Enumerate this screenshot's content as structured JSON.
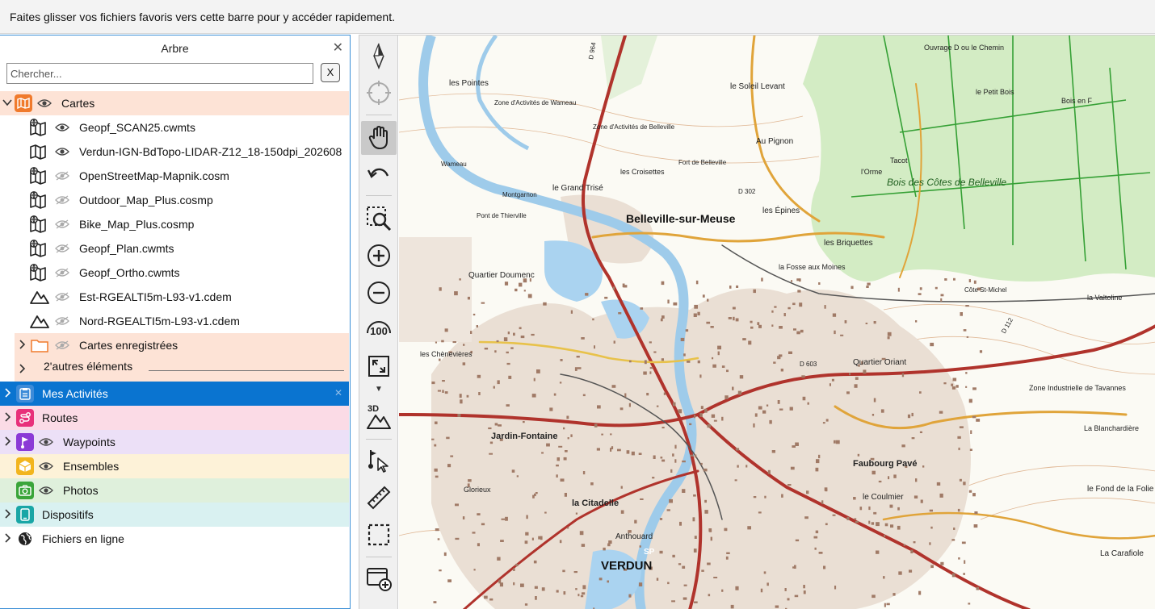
{
  "favorites_bar": {
    "text": "Faites glisser vos fichiers favoris vers cette barre pour y accéder rapidement."
  },
  "panel": {
    "title": "Arbre",
    "close_label": "✕",
    "search": {
      "placeholder": "Chercher...",
      "value": "",
      "clear_label": "X"
    }
  },
  "tree": {
    "cartes": {
      "label": "Cartes",
      "color": "#f07a2c"
    },
    "maps": [
      {
        "label": "Geopf_SCAN25.cwmts",
        "icon": "online-map-icon",
        "visible": true
      },
      {
        "label": "Verdun-IGN-BdTopo-LIDAR-Z12_18-150dpi_202608",
        "icon": "map-icon",
        "visible": true
      },
      {
        "label": "OpenStreetMap-Mapnik.cosm",
        "icon": "online-map-icon",
        "visible": false
      },
      {
        "label": "Outdoor_Map_Plus.cosmp",
        "icon": "online-map-icon",
        "visible": false
      },
      {
        "label": "Bike_Map_Plus.cosmp",
        "icon": "online-map-icon",
        "visible": false
      },
      {
        "label": "Geopf_Plan.cwmts",
        "icon": "online-map-icon",
        "visible": false
      },
      {
        "label": "Geopf_Ortho.cwmts",
        "icon": "online-map-icon",
        "visible": false
      },
      {
        "label": "Est-RGEALTI5m-L93-v1.cdem",
        "icon": "elevation-icon",
        "visible": false
      },
      {
        "label": "Nord-RGEALTI5m-L93-v1.cdem",
        "icon": "elevation-icon",
        "visible": false
      }
    ],
    "saved_maps": {
      "label": "Cartes enregistrées"
    },
    "other_items": {
      "label": "2'autres éléments"
    },
    "sections": [
      {
        "label": "Mes Activités",
        "color": "#3d8bd8",
        "bg": "#0a74d0",
        "selected": true
      },
      {
        "label": "Routes",
        "color": "#e8317a",
        "bg": "#fbdbe6"
      },
      {
        "label": "Waypoints",
        "color": "#8b3ad6",
        "bg": "#ece0f7"
      },
      {
        "label": "Ensembles",
        "color": "#f2b51e",
        "bg": "#fdf2d8"
      },
      {
        "label": "Photos",
        "color": "#3aa53a",
        "bg": "#dff0dc"
      },
      {
        "label": "Dispositifs",
        "color": "#19a6a6",
        "bg": "#d9f1f1"
      },
      {
        "label": "Fichiers en ligne",
        "color": "#222222",
        "bg": "#ffffff"
      }
    ]
  },
  "toolbar": {
    "tools": [
      "north-arrow-icon",
      "locate-icon",
      "pan-hand-icon",
      "undo-icon",
      "zoom-selection-icon",
      "zoom-in-icon",
      "zoom-out-icon",
      "zoom-100-icon",
      "fit-extent-icon",
      "3d-view-icon",
      "select-cursor-icon",
      "ruler-icon",
      "selection-box-icon",
      "add-layer-icon"
    ],
    "zoom_100_label": "100",
    "view_3d_label": "3D"
  },
  "map": {
    "labels": {
      "belleville": "Belleville-sur-Meuse",
      "verdun": "VERDUN",
      "jardin_fontaine": "Jardin-Fontaine",
      "la_citadelle": "la Citadelle",
      "faubourg_pave": "Faubourg Pavé",
      "bois_cotes": "Bois des Côtes de Belleville",
      "quartier_doumenc": "Quartier Doumenc",
      "zone_industrielle": "Zone Industrielle de Tavannes",
      "la_blanchardiere": "La Blanchardière",
      "le_fond_folie": "le Fond de la Folie",
      "la_carafiole": "La Carafiole",
      "les_pointes": "les Pointes",
      "grand_trise": "le Grand Trisé",
      "le_soleil_levant": "le Soleil Levant",
      "au_pignon": "Au Pignon",
      "les_epines": "les Épines",
      "les_briquettes": "les Briquettes",
      "la_fosse_moines": "la Fosse aux Moines",
      "quartier_oriant": "Quartier Oriant",
      "le_coulmier": "le Coulmier",
      "les_chenevieres": "les Chènevières",
      "la_valtoline": "la Valtoline",
      "cote_st_michel": "Côte St-Michel",
      "bois_en_f": "Bois en F",
      "tacot": "Tacot",
      "lorme": "l'Orme",
      "glorieux": "Glorieux",
      "anthouard": "Anthouard",
      "fort_belleville": "Fort de Belleville",
      "zone_wameau": "Zone d'Activités de Wameau",
      "zone_belleville": "Zone d'Activités de Belleville",
      "les_croisettes": "les Croisettes",
      "montgarnon": "Montgarnon",
      "wameau": "Wameau",
      "pont_thierville": "Pont de Thierville",
      "ouvrage": "Ouvrage D ou le Chemin",
      "le_petit_bois": "le Petit Bois",
      "sp": "SP",
      "d964": "D 964",
      "d302": "D 302",
      "d603": "D 603",
      "d112": "D 112"
    }
  }
}
